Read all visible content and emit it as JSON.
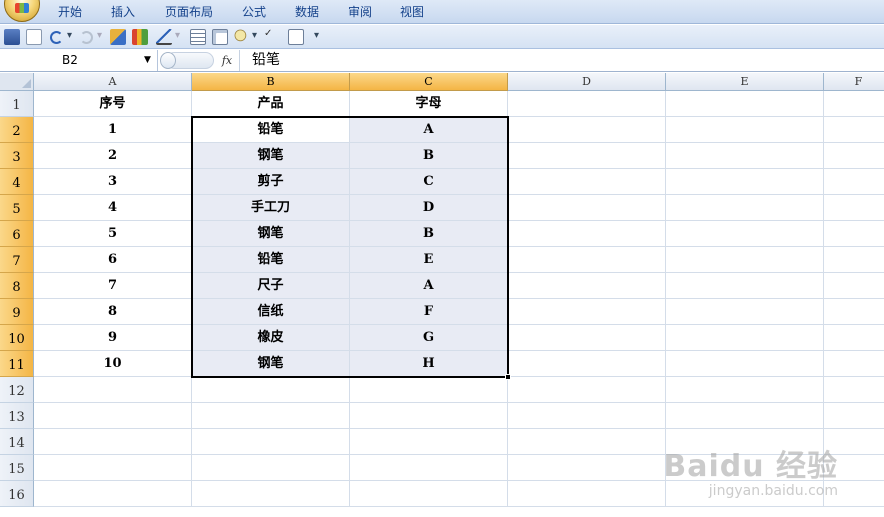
{
  "ribbon": {
    "tabs": [
      "开始",
      "插入",
      "页面布局",
      "公式",
      "数据",
      "审阅",
      "视图"
    ]
  },
  "quick_access": {
    "icons": [
      "save-icon",
      "new-icon",
      "undo-icon",
      "redo-icon",
      "format-painter-icon",
      "chart-icon",
      "line-chart-icon",
      "table-icon",
      "form-icon",
      "find-icon",
      "spelling-icon",
      "print-preview-icon",
      "customize-icon"
    ]
  },
  "formula_bar": {
    "name_box": "B2",
    "fx_label": "fx",
    "content": "铅笔"
  },
  "columns": [
    "A",
    "B",
    "C",
    "D",
    "E",
    "F"
  ],
  "rows": [
    "1",
    "2",
    "3",
    "4",
    "5",
    "6",
    "7",
    "8",
    "9",
    "10",
    "11",
    "12",
    "13",
    "14",
    "15",
    "16"
  ],
  "cells": {
    "header": [
      "序号",
      "产品",
      "字母"
    ],
    "data": [
      [
        "1",
        "铅笔",
        "A"
      ],
      [
        "2",
        "钢笔",
        "B"
      ],
      [
        "3",
        "剪子",
        "C"
      ],
      [
        "4",
        "手工刀",
        "D"
      ],
      [
        "5",
        "钢笔",
        "B"
      ],
      [
        "6",
        "铅笔",
        "E"
      ],
      [
        "7",
        "尺子",
        "A"
      ],
      [
        "8",
        "信纸",
        "F"
      ],
      [
        "9",
        "橡皮",
        "G"
      ],
      [
        "10",
        "钢笔",
        "H"
      ]
    ]
  },
  "selection": {
    "range": "B2:C11",
    "active_cell": "B2"
  },
  "colors": {
    "selection_fill": "#e8ebf4",
    "header_selected": "#f4b545",
    "ribbon_text": "#15428b"
  },
  "watermark": {
    "main": "Baidu 经验",
    "sub": "jingyan.baidu.com"
  }
}
